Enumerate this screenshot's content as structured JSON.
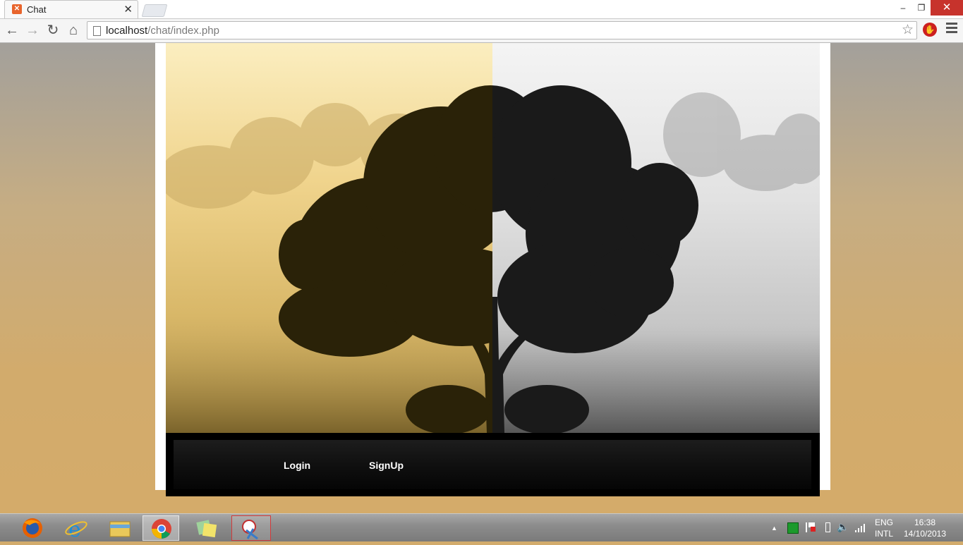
{
  "browser": {
    "tab_title": "Chat",
    "tab_close": "✕",
    "url_host": "localhost",
    "url_path": "/chat/index.php",
    "win_minimize": "–",
    "win_restore": "❐",
    "win_close": "✕"
  },
  "toolbar": {
    "back": "←",
    "forward": "→",
    "reload": "↻",
    "home": "⌂",
    "star": "☆"
  },
  "page": {
    "nav": {
      "login": "Login",
      "signup": "SignUp"
    }
  },
  "taskbar": {
    "apps": [
      "firefox-icon",
      "internet-explorer-icon",
      "file-explorer-icon",
      "chrome-icon",
      "sticky-notes-icon",
      "snipping-tool-icon"
    ],
    "language_top": "ENG",
    "language_bottom": "INTL",
    "time": "16:38",
    "date": "14/10/2013",
    "show_hidden": "▲"
  },
  "colors": {
    "accent_close": "#c7332c",
    "page_bg": "#d2ab6c",
    "navbar": "#000000"
  }
}
